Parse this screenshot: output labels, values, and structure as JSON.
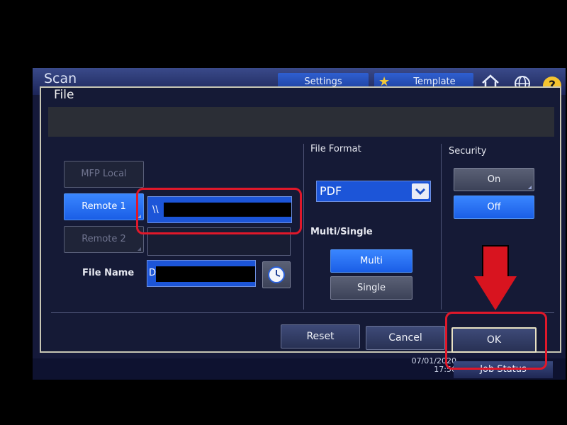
{
  "screen": {
    "title": "Scan",
    "settings_tab": "Settings",
    "template_tab": "Template",
    "help_icon_glyph": "?",
    "date": "07/01/2020",
    "time": "17:56",
    "job_status": "Job Status"
  },
  "dialog": {
    "title": "File",
    "destinations": {
      "mfp_local": "MFP Local",
      "remote_1": "Remote 1",
      "remote_2": "Remote 2"
    },
    "remote_1_path_prefix": "\\\\",
    "file_name_label": "File Name",
    "file_name_prefix": "D",
    "file_format": {
      "label": "File Format",
      "selected": "PDF"
    },
    "multi_single": {
      "label": "Multi/Single",
      "multi": "Multi",
      "single": "Single",
      "selected": "Multi"
    },
    "security": {
      "label": "Security",
      "on": "On",
      "off": "Off",
      "selected": "Off"
    },
    "buttons": {
      "reset": "Reset",
      "cancel": "Cancel",
      "ok": "OK"
    }
  },
  "colors": {
    "active_blue": "#2a73f5",
    "annotation_red": "#e0182a",
    "dialog_bg": "#151a36"
  }
}
